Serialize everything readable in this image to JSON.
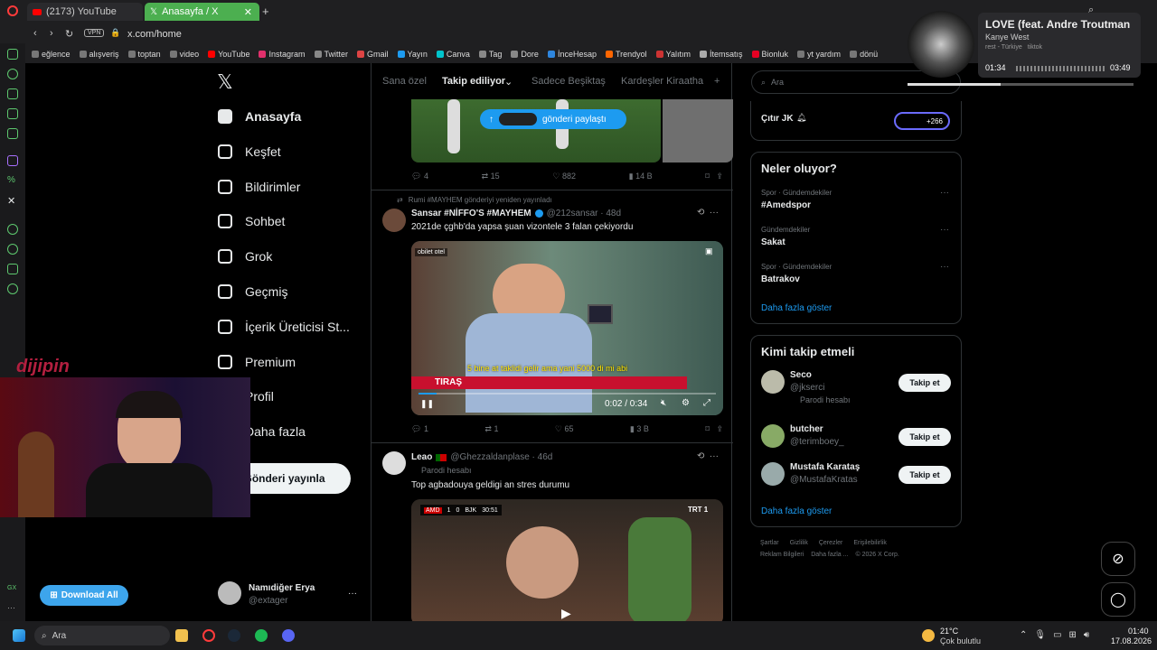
{
  "browser": {
    "tabs": [
      {
        "label": "(2173) YouTube"
      },
      {
        "label": "Anasayfa / X"
      }
    ],
    "vpn": "VPN",
    "url": "x.com/home",
    "bookmarks": [
      "eğlence",
      "alışveriş",
      "toptan",
      "video",
      "YouTube",
      "Instagram",
      "Twitter",
      "Gmail",
      "Yayın",
      "Canva",
      "Tag",
      "Dore",
      "İnceHesap",
      "Trendyol",
      "Yalıtım",
      "İtemsatış",
      "Bionluk",
      "yt yardım",
      "dönü"
    ]
  },
  "music": {
    "title": "LOVE (feat. Andre Troutman",
    "artist": "Kanye West",
    "elapsed": "01:34",
    "duration": "03:49",
    "progress": 0.41,
    "extra1": "rest - Türkiye",
    "extra2": "tiktok"
  },
  "nav": {
    "items": [
      "Anasayfa",
      "Keşfet",
      "Bildirimler",
      "Sohbet",
      "Grok",
      "Geçmiş",
      "İçerik Üreticisi St...",
      "Premium",
      "Profil",
      "Daha fazla"
    ],
    "post_button": "Gönderi yayınla",
    "user_name": "Namıdiğer Erya",
    "user_handle": "@extager",
    "more": "···"
  },
  "feed": {
    "tabs": [
      "Sana özel",
      "Takip ediliyor",
      "Sadece Beşiktaş",
      "Kardeşler Kiraatha"
    ],
    "plus": "+",
    "shared_banner": "gönderi paylaştı",
    "t1_actions": {
      "reply": "4",
      "retweet": "15",
      "like": "882",
      "views": "14 B"
    },
    "t2": {
      "repost_note": "Rumi #MAYHEM gönderiyi yeniden yayınladı",
      "name": "Sansar #NİFFO'S #MAYHEM",
      "handle": "@212sansar · 48d",
      "text": "2021de çghb'da yapsa şuan vizontele 3 falan çekiyordu",
      "caption": "5 bine at taklidi gelir ama yani 5000 di mi abi",
      "channel": "obilet otel",
      "lower_ticker": "TIRAŞ",
      "time": "0:02 / 0:34",
      "actions": {
        "reply": "1",
        "retweet": "1",
        "like": "65",
        "views": "3 B"
      }
    },
    "t3": {
      "name": "Leao",
      "handle": "@Ghezzaldanplase · 46d",
      "parody": "Parodi hesabı",
      "text": "Top agbadouya geldigi an stres durumu",
      "score_home": "AMD",
      "score_h": "1",
      "score_a": "0",
      "score_away": "BJK",
      "clock": "30:51",
      "tv": "TRT 1"
    }
  },
  "sidebar": {
    "search_placeholder": "Ara",
    "top_name": "Çıtır JK",
    "top_badge": "+266",
    "trends_title": "Neler oluyor?",
    "trends": [
      {
        "sub": "Spor · Gündemdekiler",
        "name": "#Amedspor"
      },
      {
        "sub": "Gündemdekiler",
        "name": "Sakat"
      },
      {
        "sub": "Spor · Gündemdekiler",
        "name": "Batrakov"
      }
    ],
    "show_more": "Daha fazla göster",
    "who_title": "Kimi takip etmeli",
    "who": [
      {
        "name": "Seco",
        "handle": "@jkserci",
        "note": "Parodi hesabı"
      },
      {
        "name": "butcher",
        "handle": "@terimboey_",
        "note": ""
      },
      {
        "name": "Mustafa Karataş",
        "handle": "@MustafaKratas",
        "note": ""
      }
    ],
    "follow_label": "Takip et",
    "show_more2": "Daha fazla göster",
    "footer1": [
      "Şartlar",
      "Gizlilik",
      "Çerezler",
      "Erişilebilirlik"
    ],
    "footer2": [
      "Reklam Bilgileri",
      "Daha fazla ...",
      "© 2026 X Corp."
    ]
  },
  "overlay": {
    "brand": "dijipin",
    "download_label": "Download All"
  },
  "taskbar": {
    "search": "Ara",
    "temp": "21°C",
    "weather": "Çok bulutlu",
    "time": "01:40",
    "date": "17.08.2026"
  }
}
